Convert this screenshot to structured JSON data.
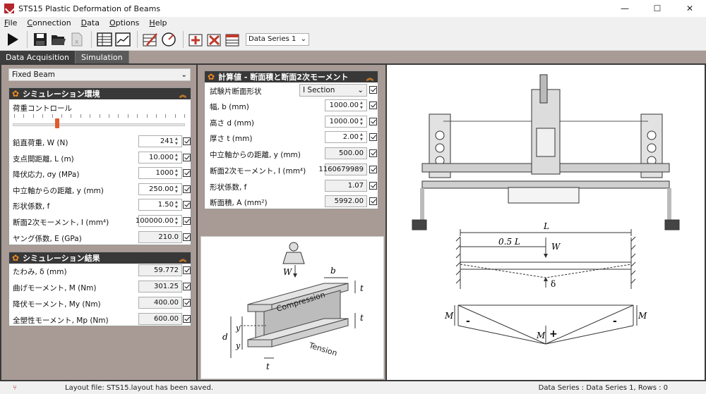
{
  "window": {
    "title": "STS15 Plastic Deformation of Beams",
    "controls": {
      "minimize": "—",
      "maximize": "☐",
      "close": "✕"
    }
  },
  "menu": [
    "File",
    "Connection",
    "Data",
    "Options",
    "Help"
  ],
  "toolbar": {
    "data_series": "Data Series 1"
  },
  "tabs": [
    {
      "label": "Data Acquisition",
      "active": true
    },
    {
      "label": "Simulation",
      "active": false
    }
  ],
  "left": {
    "beam_type": "Fixed Beam",
    "sim_env": {
      "title": "シミュレーション環境",
      "load_control_label": "荷重コントロール",
      "load_control_level": 0.26,
      "rows": [
        {
          "label": "鉛直荷重, W (N)",
          "value": "241"
        },
        {
          "label": "支点間距離, L (m)",
          "value": "10.000"
        },
        {
          "label": "降伏応力, σy (MPa)",
          "value": "1000"
        },
        {
          "label": "中立軸からの距離, y (mm)",
          "value": "250.00"
        },
        {
          "label": "形状係数, f",
          "value": "1.50"
        },
        {
          "label": "断面2次モーメント, I (mm⁴)",
          "value": "100000.00"
        },
        {
          "label": "ヤング係数, E (GPa)",
          "value": "210.0"
        }
      ]
    },
    "sim_results": {
      "title": "シミュレーション結果",
      "rows": [
        {
          "label": "たわみ, δ (mm)",
          "value": "59.772"
        },
        {
          "label": "曲げモーメント, M (Nm)",
          "value": "301.25"
        },
        {
          "label": "降伏モーメント, My (Nm)",
          "value": "400.00"
        },
        {
          "label": "全塑性モーメント, Mp (Nm)",
          "value": "600.00"
        }
      ]
    }
  },
  "center": {
    "title": "計算値 - 断面積と断面2次モーメント",
    "section_label": "試験片断面形状",
    "section_value": "I Section",
    "rows": [
      {
        "label": "幅, b (mm)",
        "value": "1000.00"
      },
      {
        "label": "高さ d (mm)",
        "value": "1000.00"
      },
      {
        "label": "厚さ t (mm)",
        "value": "2.00"
      },
      {
        "label": "中立軸からの距離, y (mm)",
        "value": "500.00"
      },
      {
        "label": "断面2次モーメント, I (mm⁴)",
        "value": "1160679989"
      },
      {
        "label": "形状係数, f",
        "value": "1.07"
      },
      {
        "label": "断面積, A (mm²)",
        "value": "5992.00"
      }
    ],
    "diagram": {
      "W": "W",
      "b": "b",
      "t": "t",
      "d": "d",
      "y": "y",
      "compression": "Compression",
      "tension": "Tension"
    }
  },
  "right": {
    "beam": {
      "L": "L",
      "half": "0.5 L",
      "W": "W",
      "delta": "δ"
    },
    "moment": {
      "M": "M",
      "minus": "-",
      "plus": "+"
    }
  },
  "status": {
    "left": "Layout file: STS15.layout has been saved.",
    "right": "Data Series : Data Series 1,  Rows : 0"
  },
  "colors": {
    "accent": "#f28c26",
    "header": "#383838",
    "panel_bg": "#a89a95",
    "app_icon": "#b3262b"
  }
}
